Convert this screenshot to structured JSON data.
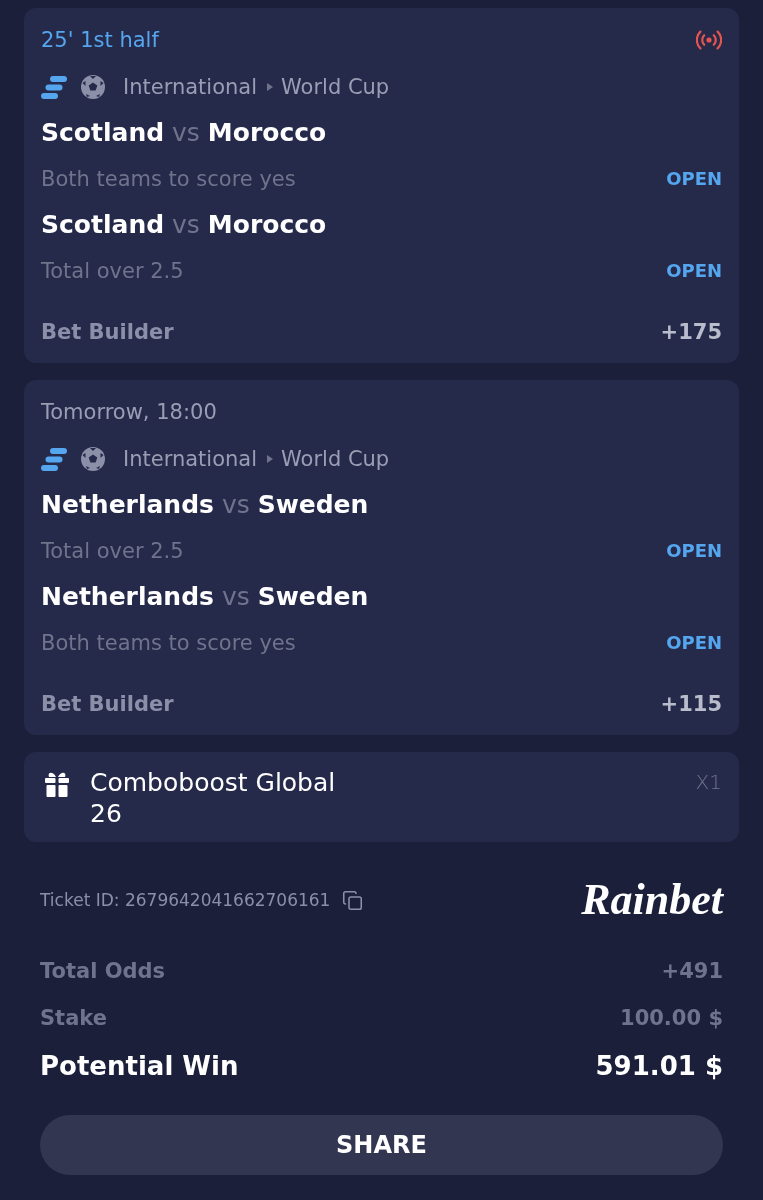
{
  "bets": [
    {
      "time": "25' 1st half",
      "live": true,
      "category": "International",
      "competition": "World Cup",
      "selections": [
        {
          "home": "Scotland",
          "separator": "vs",
          "away": "Morocco",
          "market": "Both teams to score yes",
          "status": "OPEN"
        },
        {
          "home": "Scotland",
          "separator": "vs",
          "away": "Morocco",
          "market": "Total over 2.5",
          "status": "OPEN"
        }
      ],
      "builder": {
        "label": "Bet Builder",
        "odds": "+175"
      }
    },
    {
      "time": "Tomorrow, 18:00",
      "live": false,
      "category": "International",
      "competition": "World Cup",
      "selections": [
        {
          "home": "Netherlands",
          "separator": "vs",
          "away": "Sweden",
          "market": "Total over 2.5",
          "status": "OPEN"
        },
        {
          "home": "Netherlands",
          "separator": "vs",
          "away": "Sweden",
          "market": "Both teams to score yes",
          "status": "OPEN"
        }
      ],
      "builder": {
        "label": "Bet Builder",
        "odds": "+115"
      }
    }
  ],
  "boost": {
    "title": "Comboboost Global 26",
    "multiplier": "X1"
  },
  "ticket": {
    "id": "Ticket ID: 2679642041662706161"
  },
  "brand": "Rainbet",
  "summary": [
    {
      "kind": "muted",
      "label": "Total Odds",
      "value": "+491"
    },
    {
      "kind": "muted",
      "label": "Stake",
      "value": "100.00 $"
    },
    {
      "kind": "total",
      "label": "Potential Win",
      "value": "591.01 $"
    }
  ],
  "share_button": "SHARE"
}
